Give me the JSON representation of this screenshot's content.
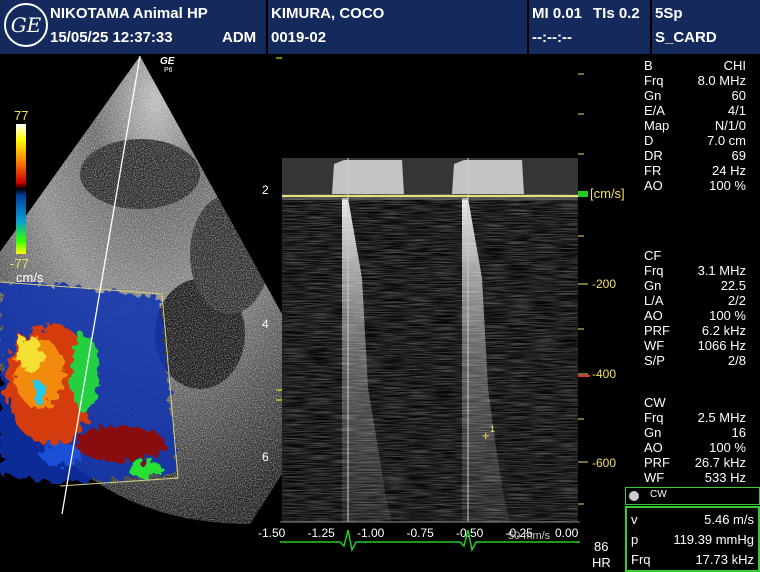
{
  "header": {
    "logo": "GE",
    "facility": "NIKOTAMA Animal HP",
    "datetime": "15/05/25 12:37:33",
    "operator": "ADM",
    "patient_name": "KIMURA, COCO",
    "patient_id": "0019-02",
    "mi": "MI 0.01",
    "tis": "TIs 0.2",
    "time_field": "--:--:--",
    "probe": "5Sp",
    "preset": "S_CARD"
  },
  "probe_marker": {
    "brand": "GE",
    "sub": "P6"
  },
  "color_scale": {
    "max": "77",
    "min": "-77",
    "unit": "cm/s"
  },
  "depth_marks": [
    "2",
    "4",
    "6"
  ],
  "params_b": [
    {
      "k": "B",
      "v": "CHI"
    },
    {
      "k": "Frq",
      "v": "8.0 MHz"
    },
    {
      "k": "Gn",
      "v": "60"
    },
    {
      "k": "E/A",
      "v": "4/1"
    },
    {
      "k": "Map",
      "v": "N/1/0"
    },
    {
      "k": "D",
      "v": "7.0 cm"
    },
    {
      "k": "DR",
      "v": "69"
    },
    {
      "k": "FR",
      "v": "24 Hz"
    },
    {
      "k": "AO",
      "v": "100 %"
    }
  ],
  "params_cf": [
    {
      "k": "CF",
      "v": ""
    },
    {
      "k": "Frq",
      "v": "3.1 MHz"
    },
    {
      "k": "Gn",
      "v": "22.5"
    },
    {
      "k": "L/A",
      "v": "2/2"
    },
    {
      "k": "AO",
      "v": "100 %"
    },
    {
      "k": "PRF",
      "v": "6.2 kHz"
    },
    {
      "k": "WF",
      "v": "1066 Hz"
    },
    {
      "k": "S/P",
      "v": "2/8"
    }
  ],
  "params_cw": [
    {
      "k": "CW",
      "v": ""
    },
    {
      "k": "Frq",
      "v": "2.5 MHz"
    },
    {
      "k": "Gn",
      "v": "16"
    },
    {
      "k": "AO",
      "v": "100 %"
    },
    {
      "k": "PRF",
      "v": "26.7 kHz"
    },
    {
      "k": "WF",
      "v": "533 Hz"
    }
  ],
  "spectrum": {
    "unit": "[cm/s]",
    "y_ticks": [
      "-200",
      "-400",
      "-600"
    ],
    "x_ticks": [
      "-1.50",
      "-1.25",
      "-1.00",
      "-0.75",
      "-0.50",
      "-0.25",
      "0.00"
    ],
    "marker": "1",
    "sweep_label": "50 mm/s",
    "hr_value": "86",
    "hr_label": "HR"
  },
  "measurement": {
    "icon": "CW",
    "rows": [
      {
        "k": "v",
        "v": "5.46 m/s"
      },
      {
        "k": "p",
        "v": "119.39 mmHg"
      },
      {
        "k": "Frq",
        "v": "17.73 kHz"
      }
    ]
  }
}
